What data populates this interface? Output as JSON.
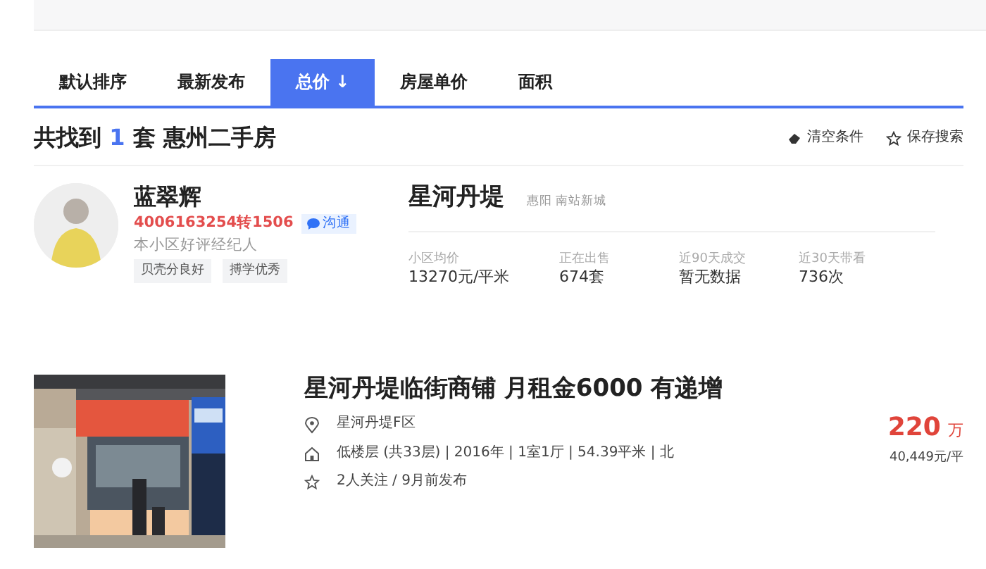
{
  "sort_tabs": [
    {
      "label": "默认排序",
      "selected": false
    },
    {
      "label": "最新发布",
      "selected": false
    },
    {
      "label": "总价 ↓",
      "selected": true
    },
    {
      "label": "房屋单价",
      "selected": false
    },
    {
      "label": "面积",
      "selected": false
    }
  ],
  "results": {
    "prefix": "共找到",
    "count": "1",
    "suffix": "套 惠州二手房"
  },
  "actions": [
    {
      "kind": "clear",
      "label": "清空条件"
    },
    {
      "kind": "save",
      "label": "保存搜索"
    }
  ],
  "agent": {
    "name": "蓝翠辉",
    "phone": "4006163254转1506",
    "chat_label": "沟通",
    "title": "本小区好评经纪人",
    "tags": [
      "贝壳分良好",
      "搏学优秀"
    ]
  },
  "community": {
    "name": "星河丹堤",
    "location": "惠阳 南站新城",
    "stats": [
      {
        "label": "小区均价",
        "value": "13270元/平米"
      },
      {
        "label": "正在出售",
        "value": "674套"
      },
      {
        "label": "近90天成交",
        "value": "暂无数据"
      },
      {
        "label": "近30天带看",
        "value": "736次"
      }
    ]
  },
  "listing": {
    "title": "星河丹堤临街商铺 月租金6000 有递增",
    "details": [
      {
        "kind": "location",
        "text": "星河丹堤F区"
      },
      {
        "kind": "house",
        "text": "低楼层 (共33层) | 2016年 | 1室1厅 | 54.39平米 | 北"
      },
      {
        "kind": "follow",
        "text": "2人关注 / 9月前发布"
      }
    ],
    "price": "220",
    "price_unit": "万",
    "unit_price": "40,449元/平"
  }
}
